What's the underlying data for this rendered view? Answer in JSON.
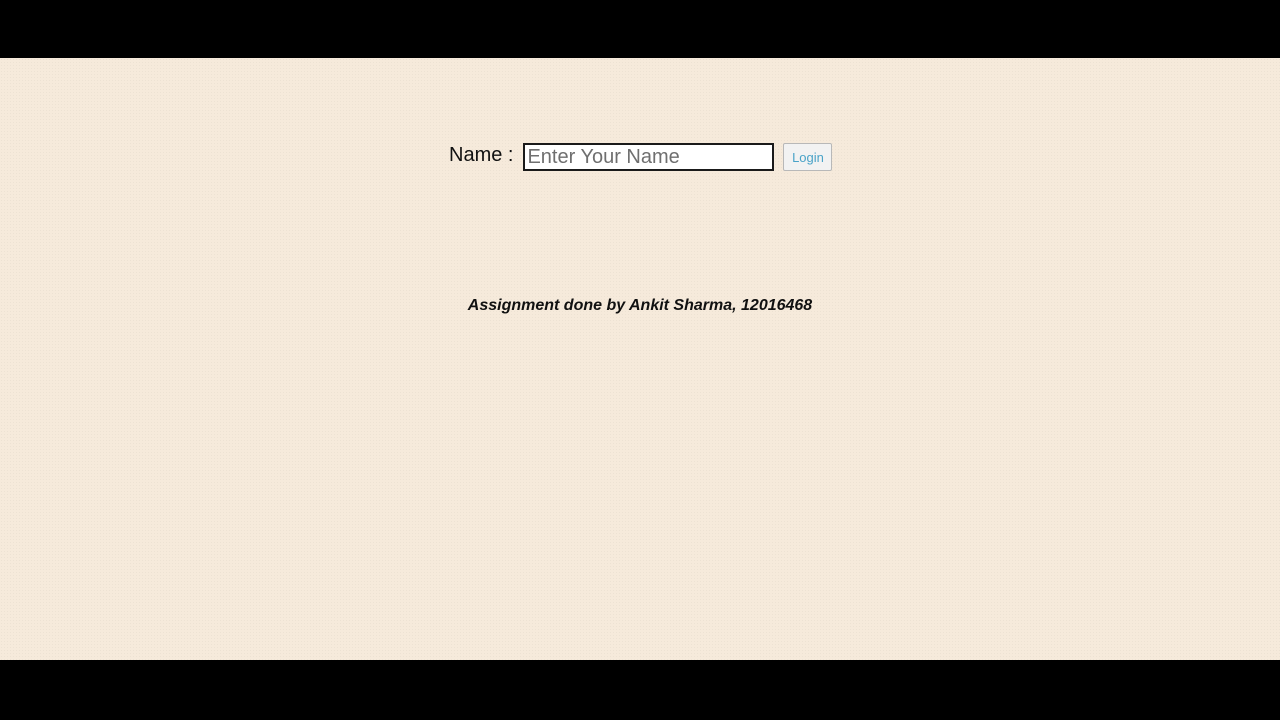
{
  "login_form": {
    "name_label": "Name :",
    "name_input_placeholder": "Enter Your Name",
    "name_input_value": "",
    "login_button_label": "Login"
  },
  "footer": {
    "credit_text": "Assignment done by Ankit Sharma, 12016468"
  },
  "colors": {
    "page_background": "#f6eadb",
    "letterbox": "#000000",
    "login_button_text": "#4aa3c8"
  }
}
